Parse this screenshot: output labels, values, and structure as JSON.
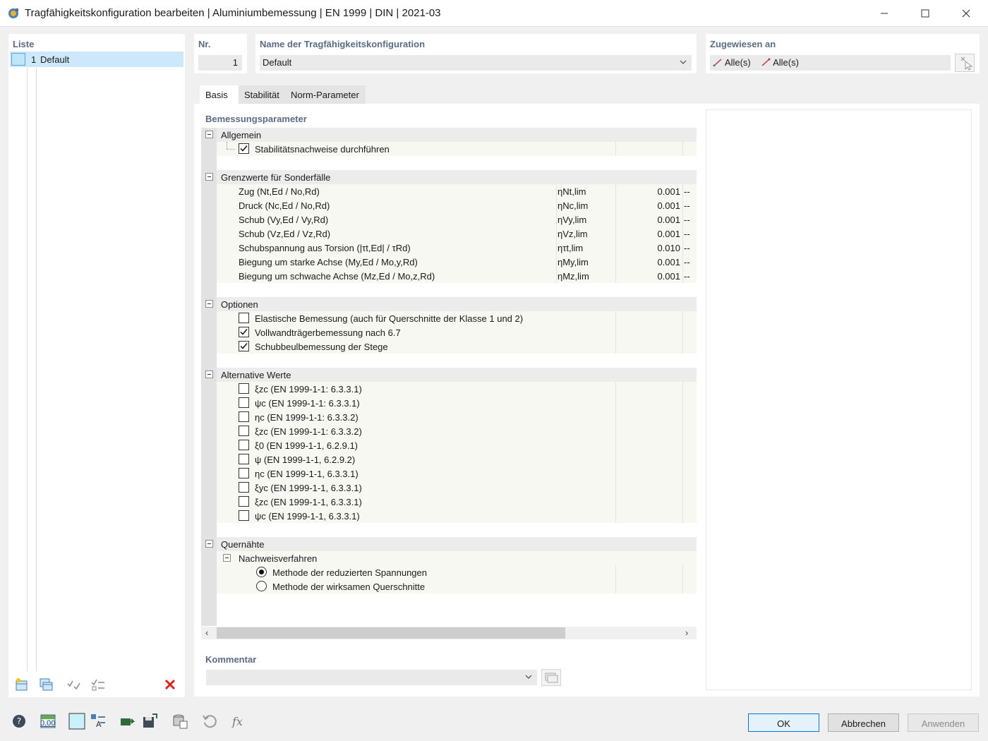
{
  "window": {
    "title": "Tragfähigkeitskonfiguration bearbeiten | Aluminiumbemessung | EN 1999 | DIN | 2021-03"
  },
  "list": {
    "header": "Liste",
    "items": [
      {
        "number": "1",
        "name": "Default"
      }
    ]
  },
  "nr": {
    "header": "Nr.",
    "value": "1"
  },
  "name": {
    "header": "Name der Tragfähigkeitskonfiguration",
    "value": "Default"
  },
  "assigned": {
    "header": "Zugewiesen an",
    "members": "Alle(s)",
    "member_sets": "Alle(s)"
  },
  "tabs": [
    {
      "label": "Basis",
      "active": true
    },
    {
      "label": "Stabilität",
      "active": false
    },
    {
      "label": "Norm-Parameter",
      "active": false
    }
  ],
  "params": {
    "header": "Bemessungsparameter",
    "general": {
      "label": "Allgemein",
      "items": [
        {
          "label": "Stabilitätsnachweise durchführen",
          "checked": true
        }
      ]
    },
    "limits": {
      "label": "Grenzwerte für Sonderfälle",
      "items": [
        {
          "label": "Zug (Nt,Ed / No,Rd)",
          "symbol": "ηNt,lim",
          "value": "0.001",
          "unit": "--"
        },
        {
          "label": "Druck (Nc,Ed / No,Rd)",
          "symbol": "ηNc,lim",
          "value": "0.001",
          "unit": "--"
        },
        {
          "label": "Schub (Vy,Ed / Vy,Rd)",
          "symbol": "ηVy,lim",
          "value": "0.001",
          "unit": "--"
        },
        {
          "label": "Schub (Vz,Ed / Vz,Rd)",
          "symbol": "ηVz,lim",
          "value": "0.001",
          "unit": "--"
        },
        {
          "label": "Schubspannung aus Torsion (|τt,Ed| / τRd)",
          "symbol": "ητt,lim",
          "value": "0.010",
          "unit": "--"
        },
        {
          "label": "Biegung um starke Achse (My,Ed / Mo,y,Rd)",
          "symbol": "ηMy,lim",
          "value": "0.001",
          "unit": "--"
        },
        {
          "label": "Biegung um schwache Achse (Mz,Ed / Mo,z,Rd)",
          "symbol": "ηMz,lim",
          "value": "0.001",
          "unit": "--"
        }
      ]
    },
    "options": {
      "label": "Optionen",
      "items": [
        {
          "label": "Elastische Bemessung (auch für Querschnitte der Klasse 1 und 2)",
          "checked": false
        },
        {
          "label": "Vollwandträgerbemessung nach 6.7",
          "checked": true
        },
        {
          "label": "Schubbeulbemessung der Stege",
          "checked": true
        }
      ]
    },
    "alternative": {
      "label": "Alternative Werte",
      "items": [
        {
          "label": "ξzc (EN 1999-1-1: 6.3.3.1)",
          "checked": false
        },
        {
          "label": "ψc (EN 1999-1-1: 6.3.3.1)",
          "checked": false
        },
        {
          "label": "ηc (EN 1999-1-1: 6.3.3.2)",
          "checked": false
        },
        {
          "label": "ξzc (EN 1999-1-1: 6.3.3.2)",
          "checked": false
        },
        {
          "label": "ξ0 (EN 1999-1-1, 6.2.9.1)",
          "checked": false
        },
        {
          "label": "ψ (EN 1999-1-1, 6.2.9.2)",
          "checked": false
        },
        {
          "label": "ηc (EN 1999-1-1, 6.3.3.1)",
          "checked": false
        },
        {
          "label": "ξyc (EN 1999-1-1, 6.3.3.1)",
          "checked": false
        },
        {
          "label": "ξzc (EN 1999-1-1, 6.3.3.1)",
          "checked": false
        },
        {
          "label": "ψc (EN 1999-1-1, 6.3.3.1)",
          "checked": false
        }
      ]
    },
    "welds": {
      "label": "Quernähte",
      "subgroup": "Nachweisverfahren",
      "items": [
        {
          "label": "Methode der reduzierten Spannungen",
          "selected": true
        },
        {
          "label": "Methode der wirksamen Querschnitte",
          "selected": false
        }
      ]
    }
  },
  "comment": {
    "header": "Kommentar",
    "value": ""
  },
  "buttons": {
    "ok": "OK",
    "cancel": "Abbrechen",
    "apply": "Anwenden"
  },
  "bottom_icons": {
    "value_display": "0,00"
  },
  "colors": {
    "accent": "#0078d7",
    "header_text": "#5a6c83",
    "selection": "#cde8fb",
    "delete_red": "#e0201b"
  }
}
